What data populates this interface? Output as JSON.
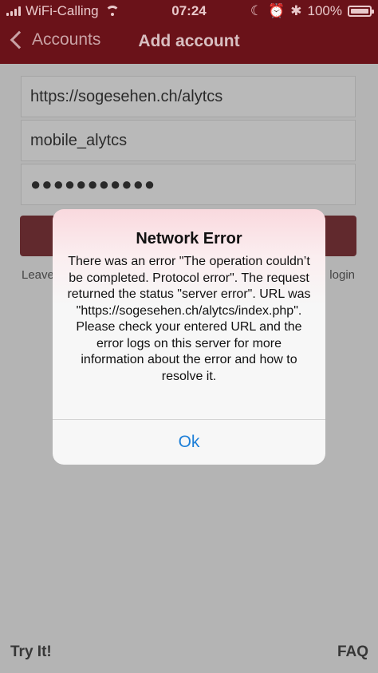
{
  "status_bar": {
    "carrier": "WiFi-Calling",
    "time": "07:24",
    "battery": "100%",
    "icons": [
      "signal-icon",
      "wifi-icon",
      "moon-icon",
      "alarm-icon",
      "bluetooth-icon",
      "battery-icon"
    ]
  },
  "nav": {
    "back_label": "Accounts",
    "title": "Add account"
  },
  "form": {
    "server_url": "https://sogesehen.ch/alytcs",
    "username": "mobile_alytcs",
    "password_mask": "●●●●●●●●●●●"
  },
  "leave_text": "Leave",
  "login_text": "login",
  "alert": {
    "title": "Network Error",
    "message": "There was an error \"The operation couldn’t be completed. Protocol error\". The request returned the status \"server error\". URL was \"https://sogesehen.ch/alytcs/index.php\". Please check your entered URL and the error logs on this server for more information about the error and how to resolve it.",
    "ok_label": "Ok"
  },
  "footer": {
    "try_it": "Try It!",
    "faq": "FAQ"
  },
  "colors": {
    "brand": "#6a1219",
    "alert_link": "#1d7fd8"
  }
}
